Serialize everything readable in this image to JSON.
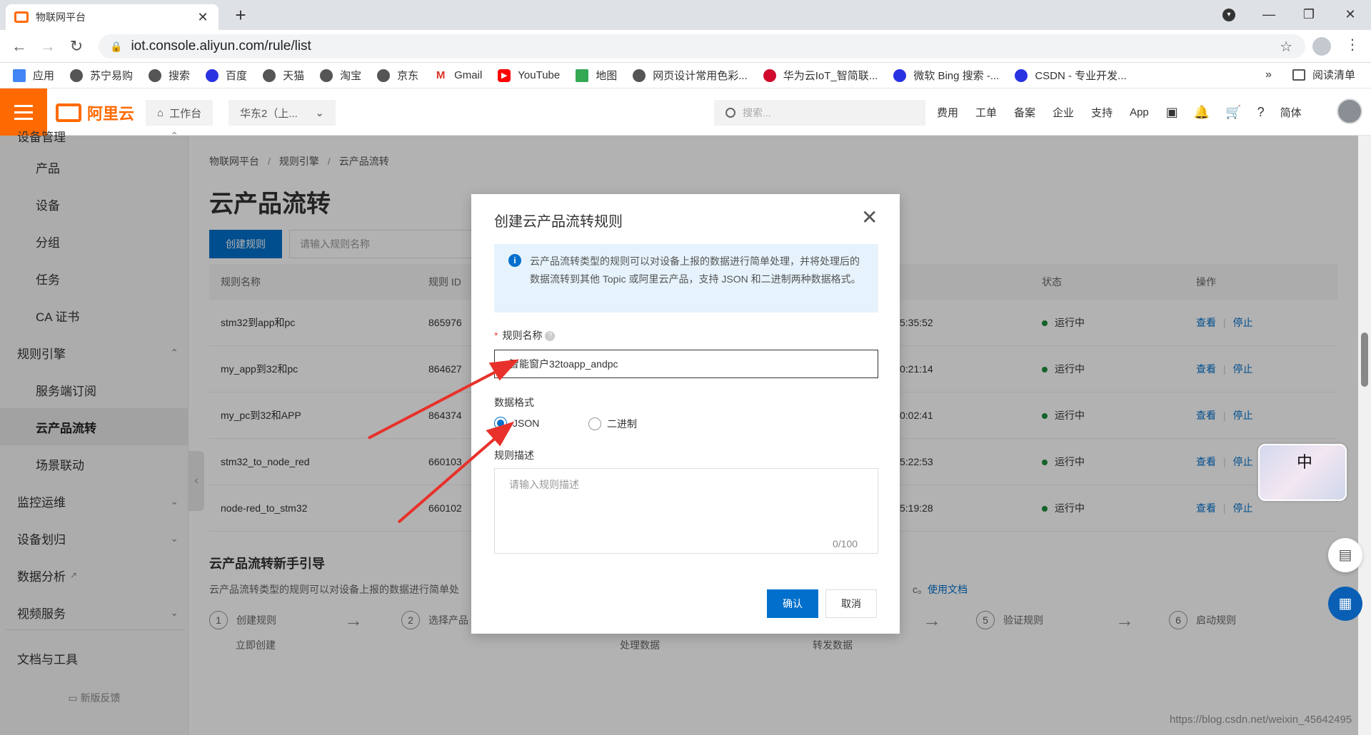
{
  "browser": {
    "tab_title": "物联网平台",
    "url": "iot.console.aliyun.com/rule/list",
    "bookmarks": [
      "应用",
      "苏宁易购",
      "搜索",
      "百度",
      "天猫",
      "淘宝",
      "京东",
      "Gmail",
      "YouTube",
      "地图",
      "网页设计常用色彩...",
      "华为云IoT_智简联...",
      "微软 Bing 搜索 -...",
      "CSDN - 专业开发..."
    ],
    "bookmarks_more": "»",
    "reading_list": "阅读清单"
  },
  "topnav": {
    "logo": "阿里云",
    "workbench": "工作台",
    "region": "华东2（上...",
    "search_placeholder": "搜索...",
    "links": [
      "费用",
      "工单",
      "备案",
      "企业",
      "支持",
      "App"
    ],
    "lang": "简体"
  },
  "sidebar": {
    "items": [
      {
        "label": "设备管理",
        "type": "top"
      },
      {
        "label": "产品",
        "type": "sub"
      },
      {
        "label": "设备",
        "type": "sub"
      },
      {
        "label": "分组",
        "type": "sub"
      },
      {
        "label": "任务",
        "type": "sub"
      },
      {
        "label": "CA 证书",
        "type": "sub"
      },
      {
        "label": "规则引擎",
        "type": "top"
      },
      {
        "label": "服务端订阅",
        "type": "sub"
      },
      {
        "label": "云产品流转",
        "type": "sub"
      },
      {
        "label": "场景联动",
        "type": "sub"
      },
      {
        "label": "监控运维",
        "type": "top"
      },
      {
        "label": "设备划归",
        "type": "top"
      },
      {
        "label": "数据分析",
        "type": "top"
      },
      {
        "label": "视频服务",
        "type": "top"
      },
      {
        "label": "文档与工具",
        "type": "top"
      }
    ],
    "feedback": "新版反馈"
  },
  "main": {
    "breadcrumb": [
      "物联网平台",
      "规则引擎",
      "云产品流转"
    ],
    "title": "云产品流转",
    "create_button": "创建规则",
    "search_placeholder": "请输入规则名称",
    "columns": [
      "规则名称",
      "规则 ID",
      "状态",
      "操作"
    ],
    "rows": [
      {
        "name": "stm32到app和pc",
        "id": "865976",
        "time": "5:35:52",
        "status": "运行中"
      },
      {
        "name": "my_app到32和pc",
        "id": "864627",
        "time": "0:21:14",
        "status": "运行中"
      },
      {
        "name": "my_pc到32和APP",
        "id": "864374",
        "time": "0:02:41",
        "status": "运行中"
      },
      {
        "name": "stm32_to_node_red",
        "id": "660103",
        "time": "5:22:53",
        "status": "运行中"
      },
      {
        "name": "node-red_to_stm32",
        "id": "660102",
        "time": "5:19:28",
        "status": "运行中"
      }
    ],
    "op_view": "查看",
    "op_stop": "停止",
    "guide_title": "云产品流转新手引导",
    "guide_desc": "云产品流转类型的规则可以对设备上报的数据进行简单处",
    "guide_desc_tail": "c。",
    "guide_doc": "使用文档",
    "steps": [
      {
        "num": "1",
        "label": "创建规则",
        "sub": "立即创建"
      },
      {
        "num": "2",
        "label": "选择产品",
        "sub": "处理数据"
      },
      {
        "num": "5",
        "label": "验证规则",
        "sub": "转发数据"
      },
      {
        "num": "6",
        "label": "启动规则",
        "sub": ""
      }
    ],
    "arrow": "→"
  },
  "dialog": {
    "title": "创建云产品流转规则",
    "info": "云产品流转类型的规则可以对设备上报的数据进行简单处理，并将处理后的数据流转到其他 Topic 或阿里云产品，支持 JSON 和二进制两种数据格式。",
    "name_label": "规则名称",
    "name_value": "智能窗户32toapp_andpc",
    "format_label": "数据格式",
    "format_options": [
      "JSON",
      "二进制"
    ],
    "format_selected": "JSON",
    "desc_label": "规则描述",
    "desc_placeholder": "请输入规则描述",
    "desc_count": "0/100",
    "ok": "确认",
    "cancel": "取消"
  },
  "widget": {
    "char": "中"
  },
  "watermark": "https://blog.csdn.net/weixin_45642495",
  "colors": {
    "brand": "#ff6a00",
    "primary": "#0070cc",
    "success": "#1e8e3e",
    "annotation": "#e8312a"
  }
}
